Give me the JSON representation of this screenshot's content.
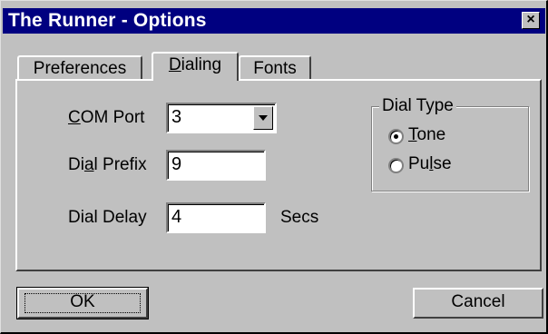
{
  "window": {
    "title": "The Runner - Options",
    "close_glyph": "×"
  },
  "tabs": [
    {
      "label": "Preferences",
      "active": false
    },
    {
      "label": "Dialing",
      "active": true
    },
    {
      "label": "Fonts",
      "active": false
    }
  ],
  "dialing": {
    "com_port": {
      "label": "COM Port",
      "value": "3"
    },
    "dial_prefix": {
      "label": "Dial Prefix",
      "value": "9"
    },
    "dial_delay": {
      "label": "Dial Delay",
      "value": "4",
      "unit": "Secs"
    },
    "dial_type": {
      "legend": "Dial Type",
      "options": [
        {
          "label": "Tone",
          "selected": true
        },
        {
          "label": "Pulse",
          "selected": false
        }
      ]
    }
  },
  "buttons": {
    "ok": "OK",
    "cancel": "Cancel"
  },
  "colors": {
    "titlebar": "#000080",
    "face": "#c0c0c0"
  }
}
